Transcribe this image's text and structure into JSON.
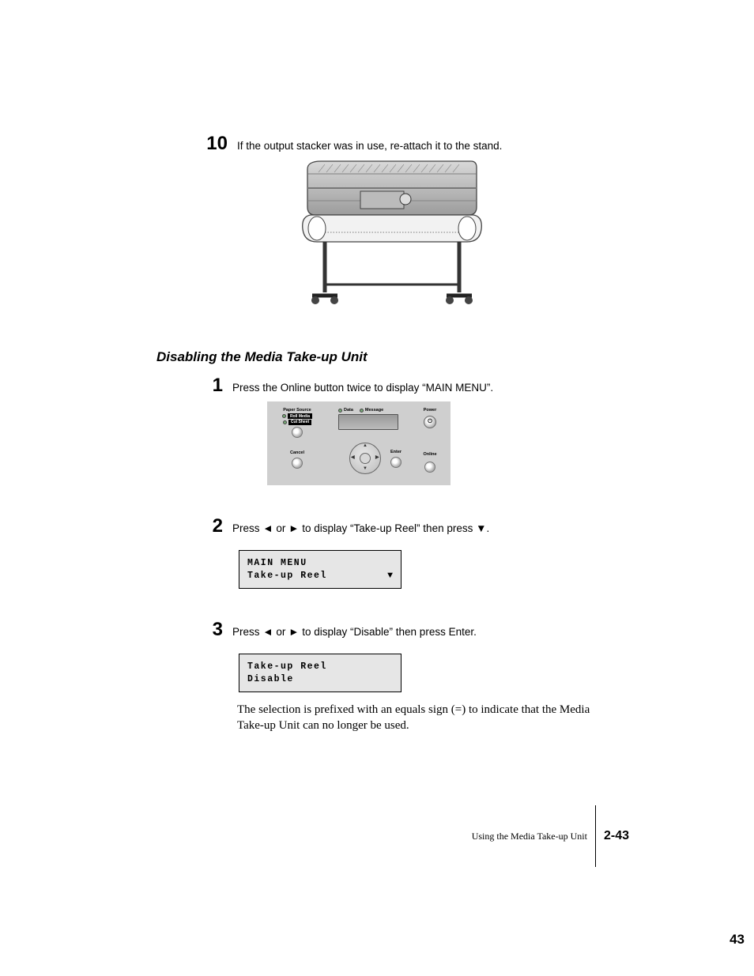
{
  "step10": {
    "num": "10",
    "text": "If the output stacker was in use, re-attach it to the stand."
  },
  "section_heading": "Disabling the Media Take-up Unit",
  "step1": {
    "num": "1",
    "text": "Press the Online button twice to display “MAIN MENU”."
  },
  "panel": {
    "paper_source": "Paper Source",
    "roll_media": "Roll Media",
    "cut_sheet": "Cut Sheet",
    "cancel": "Cancel",
    "data": "Data",
    "message": "Message",
    "enter": "Enter",
    "power": "Power",
    "online": "Online"
  },
  "step2": {
    "num": "2",
    "text": "Press ◄ or ► to display “Take-up Reel” then press ▼."
  },
  "lcd1": {
    "line1": "MAIN MENU",
    "line2": "Take-up Reel",
    "arrow": "▼"
  },
  "step3": {
    "num": "3",
    "text": "Press ◄ or ► to display “Disable” then press Enter."
  },
  "lcd2": {
    "line1": "Take-up Reel",
    "line2": "Disable"
  },
  "note": "The selection is prefixed with an equals sign (=) to indicate that the Media Take-up Unit can no longer be used.",
  "footer": {
    "title": "Using the Media Take-up Unit",
    "pagecode": "2-43"
  },
  "abs_page": "43"
}
